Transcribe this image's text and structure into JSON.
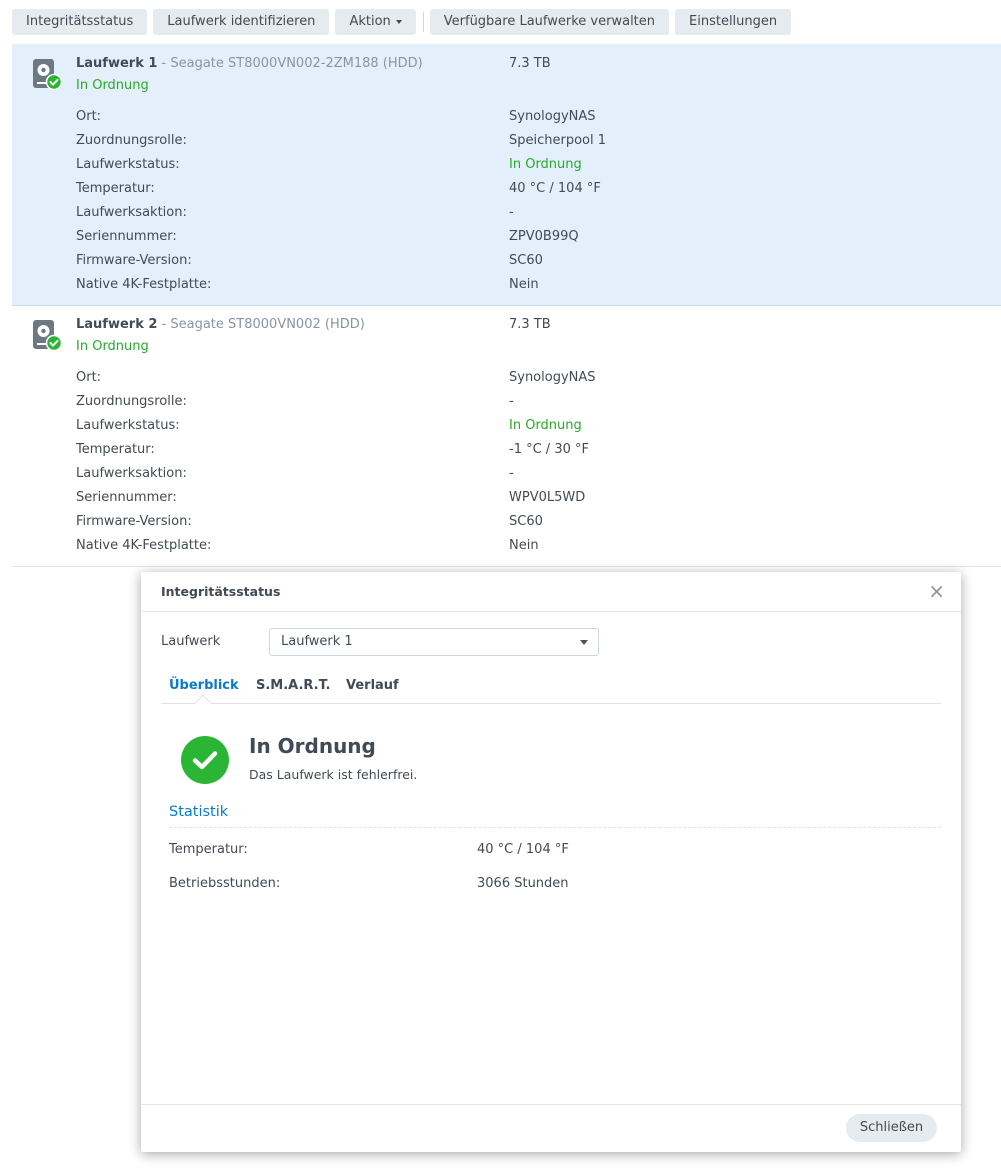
{
  "toolbar": {
    "health": "Integritätsstatus",
    "identify": "Laufwerk identifizieren",
    "action": "Aktion",
    "manage": "Verfügbare Laufwerke verwalten",
    "settings": "Einstellungen"
  },
  "drives": [
    {
      "name": "Laufwerk 1",
      "model": " - Seagate ST8000VN002-2ZM188 (HDD)",
      "size": "7.3 TB",
      "state": "In Ordnung",
      "rows": [
        {
          "label": "Ort:",
          "value": "SynologyNAS"
        },
        {
          "label": "Zuordnungsrolle:",
          "value": "Speicherpool 1"
        },
        {
          "label": "Laufwerkstatus:",
          "value": "In Ordnung"
        },
        {
          "label": "Temperatur:",
          "value": "40 °C / 104 °F"
        },
        {
          "label": "Laufwerksaktion:",
          "value": "-"
        },
        {
          "label": "Seriennummer:",
          "value": "ZPV0B99Q"
        },
        {
          "label": "Firmware-Version:",
          "value": "SC60"
        },
        {
          "label": "Native 4K-Festplatte:",
          "value": "Nein"
        }
      ]
    },
    {
      "name": "Laufwerk 2",
      "model": " - Seagate ST8000VN002 (HDD)",
      "size": "7.3 TB",
      "state": "In Ordnung",
      "rows": [
        {
          "label": "Ort:",
          "value": "SynologyNAS"
        },
        {
          "label": "Zuordnungsrolle:",
          "value": "-"
        },
        {
          "label": "Laufwerkstatus:",
          "value": "In Ordnung"
        },
        {
          "label": "Temperatur:",
          "value": "-1 °C / 30 °F"
        },
        {
          "label": "Laufwerksaktion:",
          "value": "-"
        },
        {
          "label": "Seriennummer:",
          "value": "WPV0L5WD"
        },
        {
          "label": "Firmware-Version:",
          "value": "SC60"
        },
        {
          "label": "Native 4K-Festplatte:",
          "value": "Nein"
        }
      ]
    }
  ],
  "dialog": {
    "title": "Integritätsstatus",
    "close_glyph": "×",
    "drive_label": "Laufwerk",
    "drive_selected": "Laufwerk 1",
    "tabs": [
      "Überblick",
      "S.M.A.R.T.",
      "Verlauf"
    ],
    "status_title": "In Ordnung",
    "status_desc": "Das Laufwerk ist fehlerfrei.",
    "section_title": "Statistik",
    "stats": [
      {
        "label": "Temperatur:",
        "value": "40 °C / 104 °F"
      },
      {
        "label": "Betriebsstunden:",
        "value": "3066 Stunden"
      }
    ],
    "close_button": "Schließen"
  },
  "colors": {
    "accent": "#0a7ad0",
    "ok_green": "#2aa82a",
    "selected_row": "#e3f0fc",
    "status_green": "#2bb534"
  },
  "icons": {
    "drive": "hdd-icon",
    "ok_badge": "check-badge-icon",
    "status": "check-circle-icon",
    "close": "close-icon",
    "dropdown": "caret-down-icon"
  }
}
